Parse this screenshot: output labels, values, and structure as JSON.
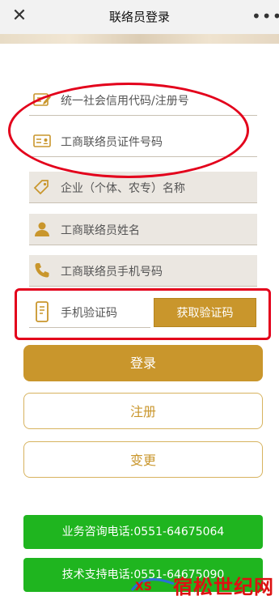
{
  "header": {
    "title": "联络员登录",
    "close_icon": "close-icon",
    "more_icon": "more-icon"
  },
  "form": {
    "credit_code_placeholder": "统一社会信用代码/注册号",
    "id_placeholder": "工商联络员证件号码",
    "company_placeholder": "企业（个体、农专）名称",
    "name_placeholder": "工商联络员姓名",
    "phone_placeholder": "工商联络员手机号码",
    "sms_placeholder": "手机验证码",
    "get_code_label": "获取验证码"
  },
  "actions": {
    "login_label": "登录",
    "register_label": "注册",
    "change_label": "变更"
  },
  "contacts": {
    "business_line": "业务咨询电话:0551-64675064",
    "tech_line": "技术支持电话:0551-64675090"
  },
  "watermark": {
    "text": "宿松世纪网",
    "badge_text": "XS"
  },
  "colors": {
    "accent": "#c9962c",
    "green": "#1fb51f",
    "annotation_red": "#e3001b"
  }
}
